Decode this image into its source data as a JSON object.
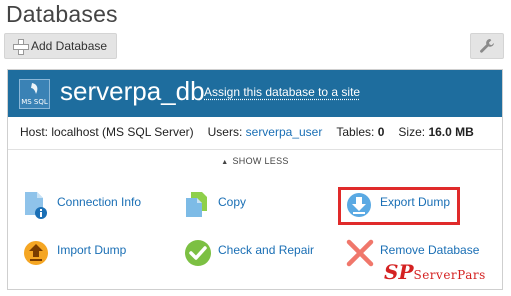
{
  "page": {
    "title": "Databases"
  },
  "toolbar": {
    "add_database_label": "Add Database",
    "wrench_icon": "wrench-icon"
  },
  "database": {
    "icon_label": "MS SQL",
    "name": "serverpa_db",
    "assign_link": "Assign this database to a site",
    "host_label": "Host:",
    "host_value": "localhost (MS SQL Server)",
    "users_label": "Users:",
    "users_value": "serverpa_user",
    "tables_label": "Tables:",
    "tables_value": "0",
    "size_label": "Size:",
    "size_value": "16.0 MB",
    "show_less": "SHOW LESS"
  },
  "actions": {
    "connection_info": "Connection Info",
    "copy": "Copy",
    "export_dump": "Export Dump",
    "import_dump": "Import Dump",
    "check_and_repair": "Check and Repair",
    "remove_database": "Remove Database"
  },
  "watermark": {
    "mark": "SP",
    "name": "ServerPars"
  },
  "colors": {
    "header": "#1e6d9e",
    "link": "#1a6fb5",
    "highlight": "#e02a2a",
    "brand": "#d42121"
  }
}
